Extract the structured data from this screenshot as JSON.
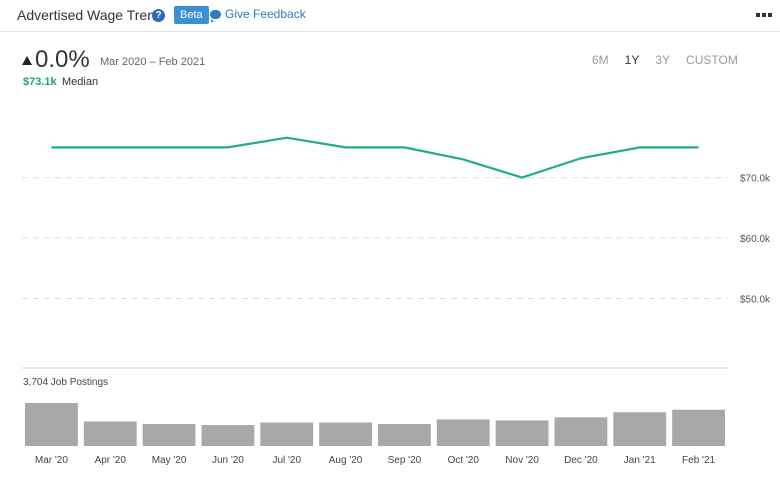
{
  "header": {
    "title": "Advertised Wage Trend",
    "help_glyph": "?",
    "beta_label": "Beta",
    "feedback_label": "Give Feedback"
  },
  "summary": {
    "change": "0.0%",
    "date_range": "Mar 2020 – Feb 2021",
    "median_value": "$73.1k",
    "median_label": "Median"
  },
  "range_buttons": [
    "6M",
    "1Y",
    "3Y",
    "CUSTOM"
  ],
  "active_range": "1Y",
  "postings_label": "3,704 Job Postings",
  "colors": {
    "line": "#21b07b",
    "bar": "#a8a8a8",
    "grid": "#dddddd"
  },
  "chart_data": [
    {
      "type": "line",
      "title": "",
      "categories": [
        "Mar '20",
        "Apr '20",
        "May '20",
        "Jun '20",
        "Jul '20",
        "Aug '20",
        "Sep '20",
        "Oct '20",
        "Nov '20",
        "Dec '20",
        "Jan '21",
        "Feb '21"
      ],
      "series": [
        {
          "values": [
            75000,
            75000,
            75000,
            75000,
            76600,
            75000,
            75000,
            73000,
            70000,
            73200,
            75000,
            75000
          ]
        }
      ],
      "y_ticks": [
        50000,
        60000,
        70000
      ],
      "y_tick_labels": [
        "$50.0k",
        "$60.0k",
        "$70.0k"
      ],
      "ylim": [
        38500,
        83500
      ],
      "grid": true,
      "grid_style": "dashed"
    },
    {
      "type": "bar",
      "title": "",
      "categories": [
        "Mar '20",
        "Apr '20",
        "May '20",
        "Jun '20",
        "Jul '20",
        "Aug '20",
        "Sep '20",
        "Oct '20",
        "Nov '20",
        "Dec '20",
        "Jan '21",
        "Feb '21"
      ],
      "series": [
        {
          "values": [
            420,
            240,
            215,
            205,
            230,
            230,
            215,
            260,
            250,
            280,
            330,
            355
          ]
        }
      ],
      "ylim": [
        0,
        440
      ]
    }
  ]
}
